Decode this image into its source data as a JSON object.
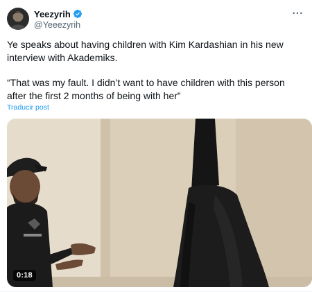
{
  "author": {
    "display_name": "Yeezyrih",
    "handle": "@Yeeezyrih",
    "verified": true,
    "avatar_icon": "avatar-photo"
  },
  "menu_icon": "more-options-icon",
  "post": {
    "paragraphs": [
      "Ye speaks about having children with Kim Kardashian in his new interview with Akademiks.",
      "“That was my fault. I didn’t want to have children with this person after the first 2 months of being with her”"
    ],
    "translate_label": "Traducir post"
  },
  "media": {
    "type": "video",
    "duration": "0:18"
  },
  "colors": {
    "accent": "#1d9bf0",
    "text": "#0f1419",
    "secondary_text": "#536471"
  }
}
